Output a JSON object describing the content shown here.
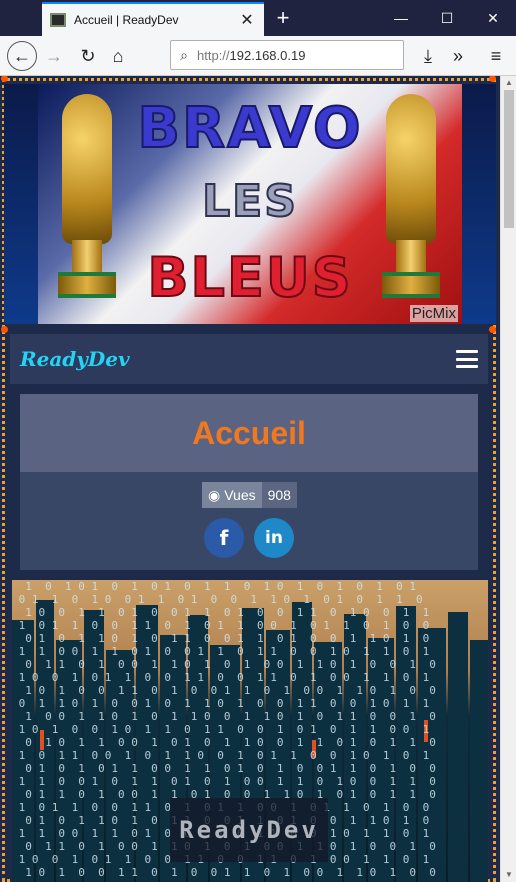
{
  "browser": {
    "tab_title": "Accueil | ReadyDev",
    "url_protocol": "http://",
    "url_host": "192.168.0.19"
  },
  "banner": {
    "line1": "BRAVO",
    "line2": "LES",
    "line3": "BLEUS",
    "watermark": "PicMix"
  },
  "site": {
    "brand": "ReadyDev"
  },
  "card": {
    "title": "Accueil",
    "views_label": "Vues",
    "views_count": "908"
  },
  "hero": {
    "title": "ReadyDev"
  },
  "colors": {
    "accent_orange": "#f07820",
    "brand_cyan": "#24d4f4",
    "facebook": "#2a5aa8",
    "linkedin": "#1e88c8"
  },
  "icons": [
    "back-icon",
    "forward-icon",
    "reload-icon",
    "home-icon",
    "search-icon",
    "download-icon",
    "overflow-icon",
    "menu-icon",
    "eye-icon",
    "facebook-icon",
    "linkedin-icon",
    "hamburger-icon"
  ]
}
